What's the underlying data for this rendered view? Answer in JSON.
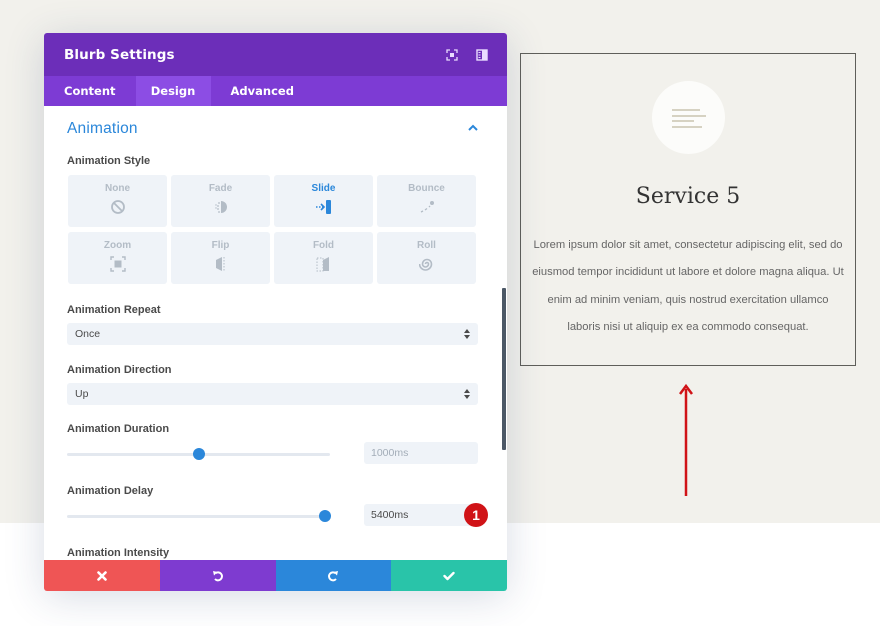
{
  "modal": {
    "title": "Blurb Settings",
    "header_icons": [
      "fullscreen-icon",
      "sidebar-layout-icon"
    ],
    "tabs": [
      {
        "label": "Content",
        "active": false
      },
      {
        "label": "Design",
        "active": true
      },
      {
        "label": "Advanced",
        "active": false
      }
    ],
    "section": {
      "title": "Animation",
      "expanded": true
    },
    "animation_style": {
      "label": "Animation Style",
      "selected": "Slide",
      "options": [
        {
          "label": "None",
          "icon": "none-icon"
        },
        {
          "label": "Fade",
          "icon": "fade-icon"
        },
        {
          "label": "Slide",
          "icon": "slide-icon"
        },
        {
          "label": "Bounce",
          "icon": "bounce-icon"
        },
        {
          "label": "Zoom",
          "icon": "zoom-icon"
        },
        {
          "label": "Flip",
          "icon": "flip-icon"
        },
        {
          "label": "Fold",
          "icon": "fold-icon"
        },
        {
          "label": "Roll",
          "icon": "roll-icon"
        }
      ]
    },
    "animation_repeat": {
      "label": "Animation Repeat",
      "value": "Once"
    },
    "animation_direction": {
      "label": "Animation Direction",
      "value": "Up"
    },
    "animation_duration": {
      "label": "Animation Duration",
      "value": "1000ms",
      "slider_fraction": 0.5,
      "is_placeholder": true
    },
    "animation_delay": {
      "label": "Animation Delay",
      "value": "5400ms",
      "slider_fraction": 0.98,
      "is_placeholder": false
    },
    "animation_intensity": {
      "label": "Animation Intensity"
    },
    "annotation_badge": "1",
    "footer": {
      "buttons": [
        {
          "name": "discard",
          "icon": "close-icon",
          "color": "#ef5555"
        },
        {
          "name": "undo",
          "icon": "undo-icon",
          "color": "#7e3bd0"
        },
        {
          "name": "redo",
          "icon": "redo-icon",
          "color": "#2b87da"
        },
        {
          "name": "save",
          "icon": "check-icon",
          "color": "#29c4a9"
        }
      ]
    },
    "colors": {
      "header": "#6c2eb9",
      "tabs": "#7d3bd4",
      "accent": "#2b87da"
    }
  },
  "preview": {
    "icon": "text-align-left-icon",
    "title": "Service 5",
    "body": "Lorem ipsum dolor sit amet, consectetur adipiscing elit, sed do eiusmod tempor incididunt ut labore et dolore magna aliqua. Ut enim ad minim veniam, quis nostrud exercitation ullamco laboris nisi ut aliquip ex ea commodo consequat.",
    "annotation_arrow": "up-arrow-icon",
    "annotation_color": "#d01317"
  }
}
